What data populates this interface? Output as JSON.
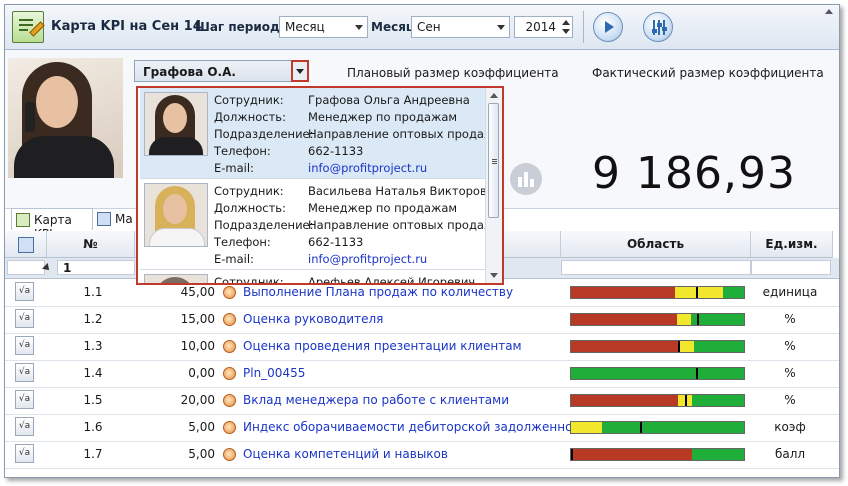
{
  "toolbar": {
    "title": "Карта KPI на Сен 14",
    "period_step_label": "Шаг периода:",
    "period_step_value": "Месяц",
    "month_label": "Месяц",
    "month_value": "Сен",
    "year_value": "2014"
  },
  "header": {
    "employee_selected": "Графова О.А.",
    "plan_label": "Плановый размер коэффициента",
    "fact_label": "Фактический размер коэффициента",
    "fact_value": "9 186,93"
  },
  "tabs": [
    {
      "label": "Карта KPI"
    },
    {
      "label": "Ма"
    }
  ],
  "dropdown": {
    "labels": {
      "employee": "Сотрудник:",
      "position": "Должность:",
      "department": "Подразделение:",
      "phone": "Телефон:",
      "email": "E-mail:"
    },
    "employees": [
      {
        "name": "Графова Ольга Андреевна",
        "position": "Менеджер по продажам",
        "department": "Направление оптовых продаж",
        "phone": "662-1133",
        "email": "info@profitproject.ru"
      },
      {
        "name": "Васильева Наталья Викторовна",
        "position": "Менеджер по продажам",
        "department": "Направление оптовых продаж",
        "phone": "662-1133",
        "email": "info@profitproject.ru"
      },
      {
        "name": "Арефьев Алексей Игоревич"
      }
    ]
  },
  "grid": {
    "columns": {
      "num": "№",
      "area": "Область",
      "unit": "Ед.изм."
    },
    "group_value": "1",
    "row_button": "√a",
    "rows": [
      {
        "num": "1.1",
        "weight": "45,00",
        "name": "Выполнение Плана продаж по количеству",
        "unit": "единица",
        "red": 0.6,
        "yellow": 0.28,
        "marker": 0.72
      },
      {
        "num": "1.2",
        "weight": "15,00",
        "name": "Оценка руководителя",
        "unit": "%",
        "red": 0.61,
        "yellow": 0.08,
        "marker": 0.73
      },
      {
        "num": "1.3",
        "weight": "10,00",
        "name": "Оценка проведения презентации клиентам",
        "unit": "%",
        "red": 0.63,
        "yellow": 0.08,
        "marker": 0.62
      },
      {
        "num": "1.4",
        "weight": "0,00",
        "name": "Pln_00455",
        "unit": "%",
        "red": 0.0,
        "yellow": 0.0,
        "marker": 0.72
      },
      {
        "num": "1.5",
        "weight": "20,00",
        "name": "Вклад менеджера по работе с клиентами",
        "unit": "%",
        "red": 0.62,
        "yellow": 0.08,
        "marker": 0.66
      },
      {
        "num": "1.6",
        "weight": "5,00",
        "name": "Индекс оборачиваемости дебиторской задолженности",
        "unit": "коэф",
        "red": 0.0,
        "yellow": 0.18,
        "marker": 0.4
      },
      {
        "num": "1.7",
        "weight": "5,00",
        "name": "Оценка компетенций и навыков",
        "unit": "балл",
        "red": 0.7,
        "yellow": 0.0,
        "marker": 0.0
      }
    ]
  },
  "colors": {
    "red": "#b83a24",
    "yellow": "#f2e72c",
    "green": "#1fae3a",
    "link": "#1a35c8"
  }
}
